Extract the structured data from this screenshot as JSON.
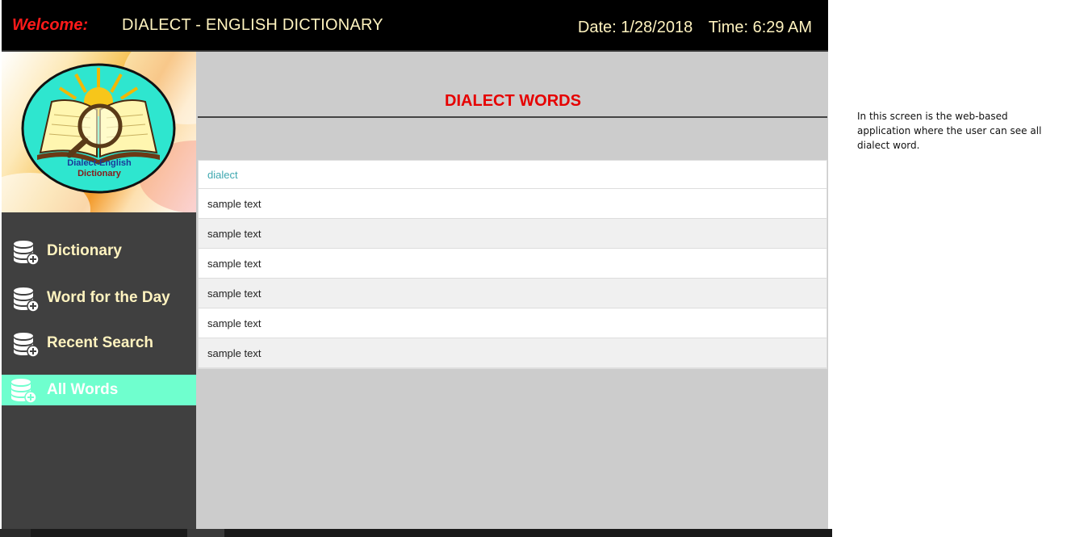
{
  "header": {
    "welcome": "Welcome:",
    "title": "DIALECT - ENGLISH DICTIONARY",
    "date_label": "Date: 1/28/2018",
    "time_label": "Time: 6:29 AM"
  },
  "logo": {
    "line1": "Dialect-English",
    "line2": "Dictionary"
  },
  "sidebar": {
    "items": [
      {
        "label": "Dictionary",
        "icon": "database-add-icon"
      },
      {
        "label": "Word for the Day",
        "icon": "database-add-icon"
      },
      {
        "label": "Recent Search",
        "icon": "database-add-icon"
      },
      {
        "label": "All Words",
        "icon": "database-add-icon",
        "active": true
      }
    ]
  },
  "main": {
    "section_title": "DIALECT WORDS",
    "list_header": "dialect",
    "rows": [
      "sample text",
      "sample text",
      "sample text",
      "sample text",
      "sample text",
      "sample text"
    ]
  },
  "annotation": "In this screen is the web-based application where the user can see all dialect word.",
  "colors": {
    "header_bg": "#000000",
    "welcome": "#ff1a1a",
    "header_text": "#fff3bf",
    "section_title": "#e60000",
    "active_nav": "#6fffce",
    "sidebar_bg": "#404040",
    "main_bg": "#cccccc"
  }
}
